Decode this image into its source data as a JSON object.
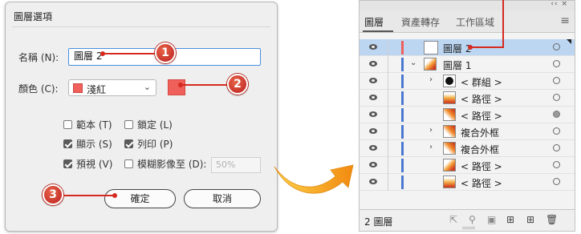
{
  "dialog": {
    "title": "圖層選項",
    "name_label": "名稱 (N):",
    "name_value": "圖層 2",
    "color_label": "顏色 (C):",
    "color_option": "淺紅",
    "color_hex": "#f0605a",
    "options": [
      {
        "label": "範本 (T)",
        "checked": false
      },
      {
        "label": "鎖定 (L)",
        "checked": false
      },
      {
        "label": "顯示 (S)",
        "checked": true
      },
      {
        "label": "列印 (P)",
        "checked": true
      },
      {
        "label": "預視 (V)",
        "checked": true
      },
      {
        "label": "模糊影像至 (D):",
        "checked": false
      }
    ],
    "dim_value": "50%",
    "ok_label": "確定",
    "cancel_label": "取消"
  },
  "callouts": [
    "1",
    "2",
    "3"
  ],
  "panel": {
    "tabs": [
      "圖層",
      "資產轉存",
      "工作區域"
    ],
    "active_tab": 0,
    "collapse_glyph": "‹‹ ×",
    "menu_glyph": "≡",
    "rows": [
      {
        "name": "圖層 2",
        "selected": true,
        "bar_color": "#f0605a",
        "twisty": "",
        "thumb": "blank",
        "target_filled": false
      },
      {
        "name": "圖層 1",
        "selected": false,
        "bar_color": "#4a78d0",
        "twisty": "⌄",
        "thumb": "grad",
        "target_filled": false
      },
      {
        "name": "< 群組 >",
        "selected": false,
        "bar_color": "#4a78d0",
        "twisty": "›",
        "thumb": "black",
        "target_filled": false
      },
      {
        "name": "< 路徑 >",
        "selected": false,
        "bar_color": "#4a78d0",
        "twisty": "",
        "thumb": "grad2",
        "target_filled": false
      },
      {
        "name": "< 路徑 >",
        "selected": false,
        "bar_color": "#4a78d0",
        "twisty": "",
        "thumb": "grad3",
        "target_filled": true
      },
      {
        "name": "複合外框",
        "selected": false,
        "bar_color": "#4a78d0",
        "twisty": "›",
        "thumb": "grad3",
        "target_filled": false
      },
      {
        "name": "複合外框",
        "selected": false,
        "bar_color": "#4a78d0",
        "twisty": "›",
        "thumb": "grad3",
        "target_filled": false
      },
      {
        "name": "< 路徑 >",
        "selected": false,
        "bar_color": "#4a78d0",
        "twisty": "",
        "thumb": "grad",
        "target_filled": false
      },
      {
        "name": "< 路徑 >",
        "selected": false,
        "bar_color": "#4a78d0",
        "twisty": "",
        "thumb": "grad2",
        "target_filled": false
      }
    ],
    "footer_count": "2 圖層",
    "footer_icons": [
      "export-icon",
      "search-icon",
      "clip-icon",
      "new-sublayer-icon",
      "new-layer-icon",
      "trash-icon"
    ]
  },
  "accent": "#d42a20",
  "arrow_color": "#f5a01e"
}
